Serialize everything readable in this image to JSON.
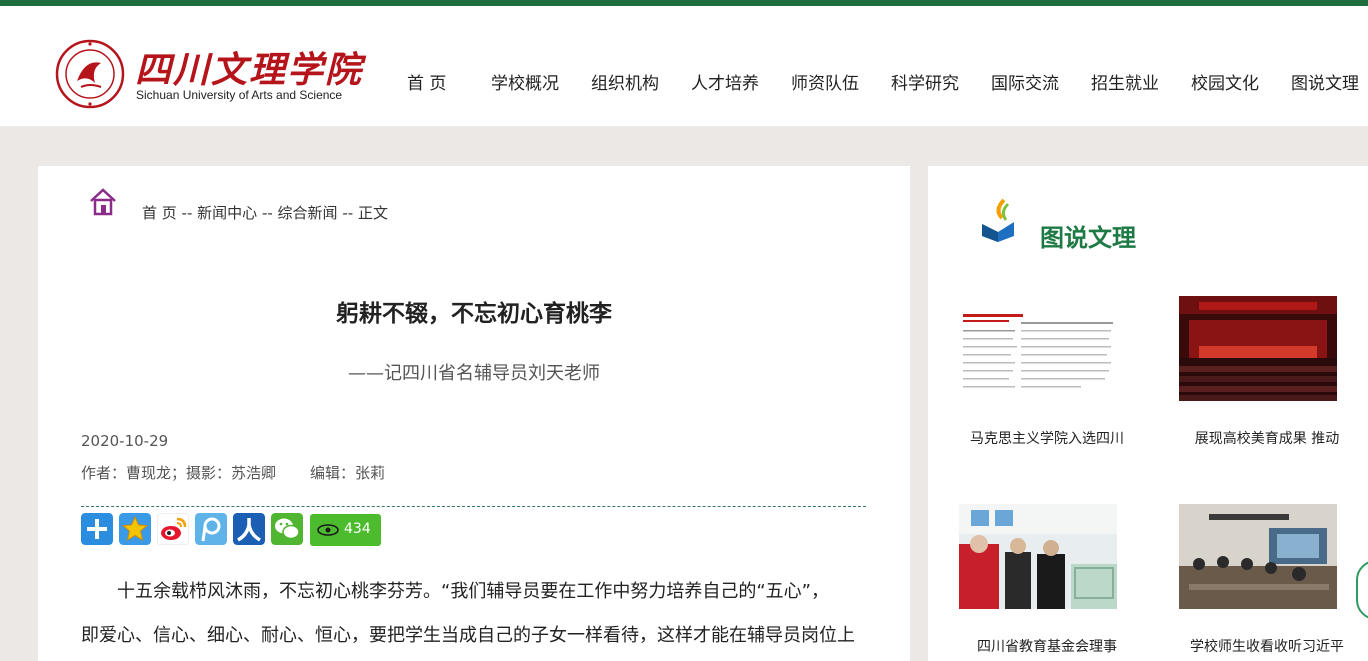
{
  "header": {
    "logo_cn": "四川文理学院",
    "logo_en": "Sichuan University of Arts and Science",
    "nav": [
      "首 页",
      "学校概况",
      "组织机构",
      "人才培养",
      "师资队伍",
      "科学研究",
      "国际交流",
      "招生就业",
      "校园文化",
      "图说文理"
    ]
  },
  "breadcrumb": {
    "home": "首 页",
    "sep1": " -- ",
    "news_center": "新闻中心",
    "sep2": " -- ",
    "general_news": "综合新闻",
    "sep3": " -- ",
    "current": "正文"
  },
  "article": {
    "title": "躬耕不辍，不忘初心育桃李",
    "subtitle": "——记四川省名辅导员刘天老师",
    "date": "2020-10-29",
    "author": "作者：曹现龙；摄影：苏浩卿",
    "editor": "编辑：张莉",
    "view_count": "434",
    "paragraph_1": "十五余载栉风沐雨，不忘初心桃李芬芳。“我们辅导员要在工作中努力培养自己的“五心”，",
    "paragraph_2": "即爱心、信心、细心、耐心、恒心，要把学生当成自己的子女一样看待，这样才能在辅导员岗位上"
  },
  "share_icons": [
    "plus-icon",
    "qzone-star-icon",
    "weibo-icon",
    "tencent-weibo-icon",
    "renren-icon",
    "wechat-icon",
    "eye-icon"
  ],
  "sidebar": {
    "title": "图说文理",
    "cards": [
      {
        "caption": "马克思主义学院入选四川"
      },
      {
        "caption": "展现高校美育成果 推动"
      },
      {
        "caption": "四川省教育基金会理事"
      },
      {
        "caption": "学校师生收看收听习近平"
      }
    ]
  },
  "colors": {
    "brand_green": "#1e6e3e",
    "brand_red": "#b5141b",
    "sidebar_title": "#1e7a45",
    "views_badge": "#4cbc2e"
  }
}
